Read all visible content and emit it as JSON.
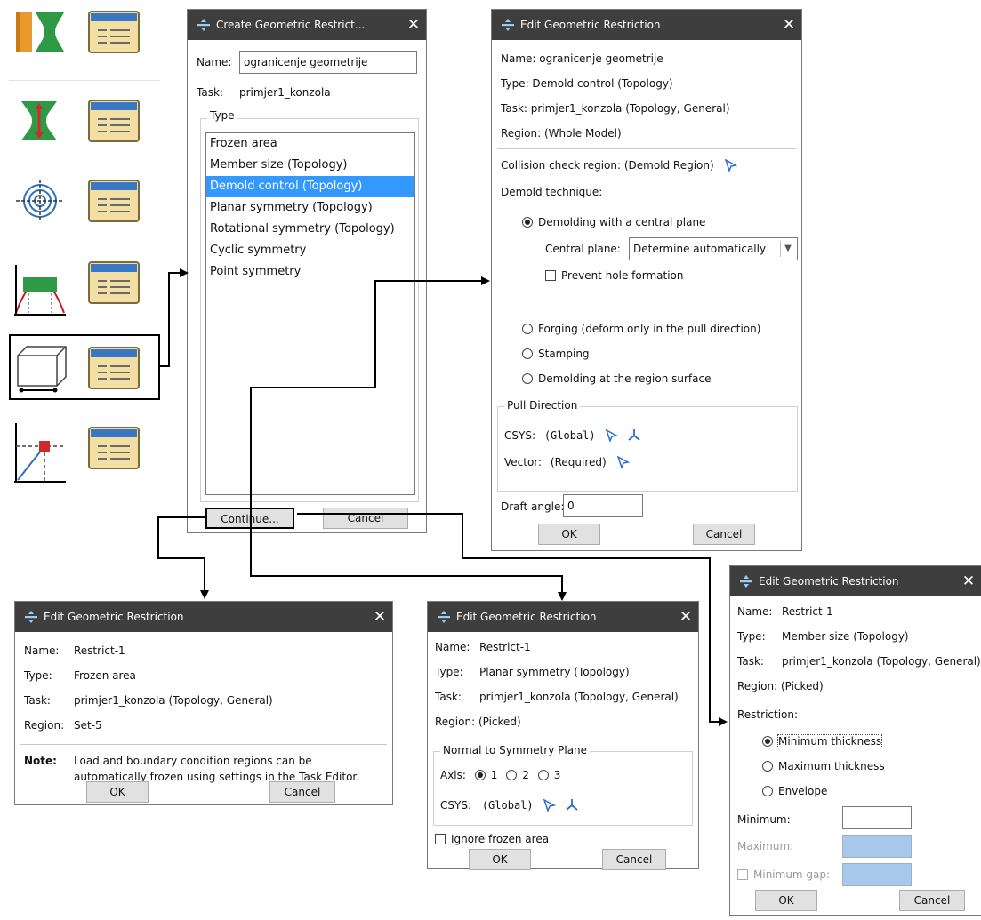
{
  "create_dialog": {
    "title": "Create Geometric Restrict...",
    "name_label": "Name:",
    "name_value": "ogranicenje geometrije",
    "task_label": "Task:",
    "task_value": "primjer1_konzola",
    "type_group": "Type",
    "types": [
      "Frozen area",
      "Member size (Topology)",
      "Demold control (Topology)",
      "Planar symmetry (Topology)",
      "Rotational symmetry (Topology)",
      "Cyclic symmetry",
      "Point symmetry"
    ],
    "continue_label": "Continue...",
    "cancel_label": "Cancel"
  },
  "demold_dialog": {
    "title": "Edit Geometric Restriction",
    "name": "Name:  ogranicenje geometrije",
    "type": "Type:   Demold control (Topology)",
    "task": "Task:   primjer1_konzola (Topology, General)",
    "region": "Region:  (Whole Model)",
    "collision": "Collision check region:  (Demold Region)",
    "technique_label": "Demold technique:",
    "opt_central": "Demolding with a central plane",
    "central_plane_label": "Central plane:",
    "central_plane_value": "Determine automatically",
    "prevent_hole": "Prevent hole formation",
    "opt_forging": "Forging (deform only in the pull direction)",
    "opt_stamping": "Stamping",
    "opt_surface": "Demolding at the region surface",
    "pull_group": "Pull Direction",
    "csys_label": "CSYS:",
    "csys_value": "(Global)",
    "vector_label": "Vector:",
    "vector_value": "(Required)",
    "draft_label": "Draft angle:",
    "draft_value": "0",
    "ok": "OK",
    "cancel": "Cancel"
  },
  "frozen_dialog": {
    "title": "Edit Geometric Restriction",
    "name_label": "Name:",
    "name_value": "Restrict-1",
    "type_label": "Type:",
    "type_value": "Frozen area",
    "task_label": "Task:",
    "task_value": "primjer1_konzola (Topology, General)",
    "region_label": "Region:",
    "region_value": "Set-5",
    "note_label": "Note:",
    "note_line1": "Load and boundary condition regions can be",
    "note_line2": "automatically frozen using settings in the Task Editor.",
    "ok": "OK",
    "cancel": "Cancel"
  },
  "planar_dialog": {
    "title": "Edit Geometric Restriction",
    "name_label": "Name:",
    "name_value": "Restrict-1",
    "type_label": "Type:",
    "type_value": "Planar symmetry (Topology)",
    "task_label": "Task:",
    "task_value": "primjer1_konzola (Topology, General)",
    "region": "Region:  (Picked)",
    "normal_group": "Normal to Symmetry Plane",
    "axis_label": "Axis:",
    "axis_1": "1",
    "axis_2": "2",
    "axis_3": "3",
    "csys_label": "CSYS:",
    "csys_value": "(Global)",
    "ignore_frozen": "Ignore frozen area",
    "ok": "OK",
    "cancel": "Cancel"
  },
  "member_dialog": {
    "title": "Edit Geometric Restriction",
    "name_label": "Name:",
    "name_value": "Restrict-1",
    "type_label": "Type:",
    "type_value": "Member size (Topology)",
    "task_label": "Task:",
    "task_value": "primjer1_konzola (Topology, General)",
    "region": "Region:  (Picked)",
    "restriction_label": "Restriction:",
    "opt_min": "Minimum thickness",
    "opt_max": "Maximum thickness",
    "opt_env": "Envelope",
    "minimum_label": "Minimum:",
    "maximum_label": "Maximum:",
    "min_gap_label": "Minimum gap:",
    "ok": "OK",
    "cancel": "Cancel"
  },
  "colors": {
    "title_bar": "#3e3e3e",
    "selection": "#3399ff",
    "toolbar_green": "#2f9a46",
    "arrow": "#000000"
  }
}
